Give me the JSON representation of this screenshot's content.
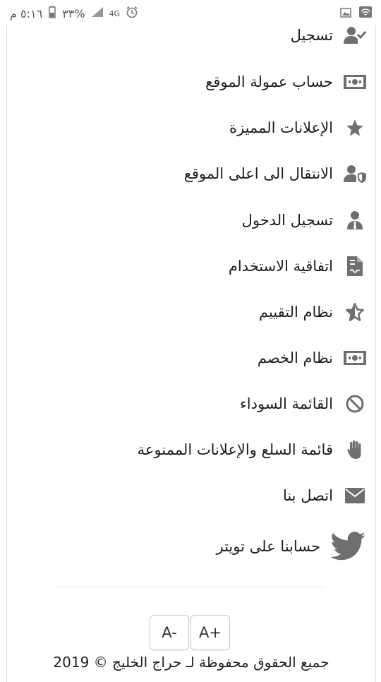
{
  "status_bar": {
    "time": "٥:١٦ م",
    "battery": "٣٣%",
    "network": "4G"
  },
  "menu": {
    "items": [
      {
        "label": "تسجيل",
        "icon": "user-check-icon"
      },
      {
        "label": "حساب عمولة الموقع",
        "icon": "money-bill-icon"
      },
      {
        "label": "الإعلانات المميزة",
        "icon": "star-icon"
      },
      {
        "label": "الانتقال الى اعلى الموقع",
        "icon": "user-shield-icon"
      },
      {
        "label": "تسجيل الدخول",
        "icon": "user-tie-icon"
      },
      {
        "label": "اتفاقية الاستخدام",
        "icon": "file-contract-icon"
      },
      {
        "label": "نظام التقييم",
        "icon": "star-outline-icon"
      },
      {
        "label": "نظام الخصم",
        "icon": "money-bill-icon"
      },
      {
        "label": "القائمة السوداء",
        "icon": "ban-icon"
      },
      {
        "label": "قائمة السلع والإعلانات الممنوعة",
        "icon": "hand-icon"
      },
      {
        "label": "اتصل بنا",
        "icon": "envelope-icon"
      },
      {
        "label": "حسابنا على تويتر",
        "icon": "twitter-icon"
      }
    ]
  },
  "font_controls": {
    "decrease": "A-",
    "increase": "A+"
  },
  "footer": {
    "copyright": "جميع الحقوق محفوظة لـ حراج الخليج © 2019"
  },
  "colors": {
    "icon": "#6f6f6f",
    "text": "#1e1e1e",
    "border": "#c8c8c8"
  }
}
